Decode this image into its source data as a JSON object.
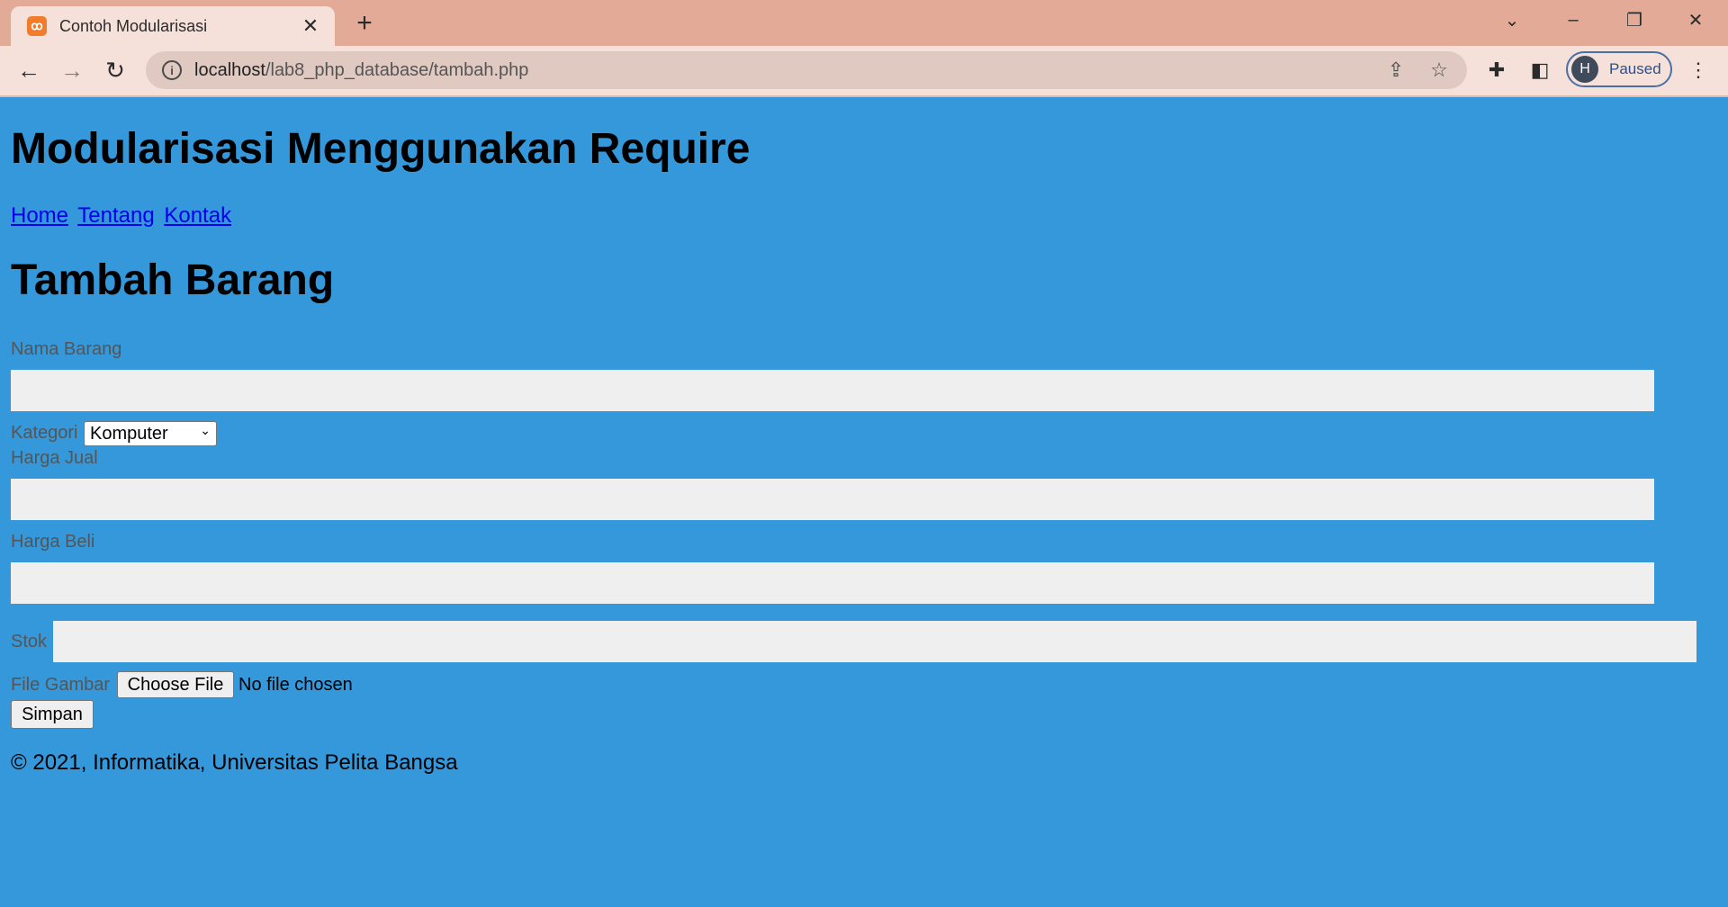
{
  "browser": {
    "tab_title": "Contoh Modularisasi",
    "url_host": "localhost",
    "url_path": "/lab8_php_database/tambah.php",
    "profile_initial": "H",
    "profile_status": "Paused"
  },
  "page": {
    "heading": "Modularisasi Menggunakan Require",
    "nav": [
      "Home",
      "Tentang",
      "Kontak"
    ],
    "form_title": "Tambah Barang",
    "labels": {
      "nama_barang": "Nama Barang",
      "kategori": "Kategori",
      "harga_jual": "Harga Jual",
      "harga_beli": "Harga Beli",
      "stok": "Stok",
      "file_gambar": "File Gambar"
    },
    "kategori_selected": "Komputer",
    "file_button": "Choose File",
    "file_status": "No file chosen",
    "submit_label": "Simpan",
    "footer": "© 2021, Informatika, Universitas Pelita Bangsa"
  },
  "colors": {
    "page_background": "#3498db",
    "tab_strip": "#e4aa98",
    "toolbar": "#f6e1da",
    "link": "#0000ee"
  }
}
